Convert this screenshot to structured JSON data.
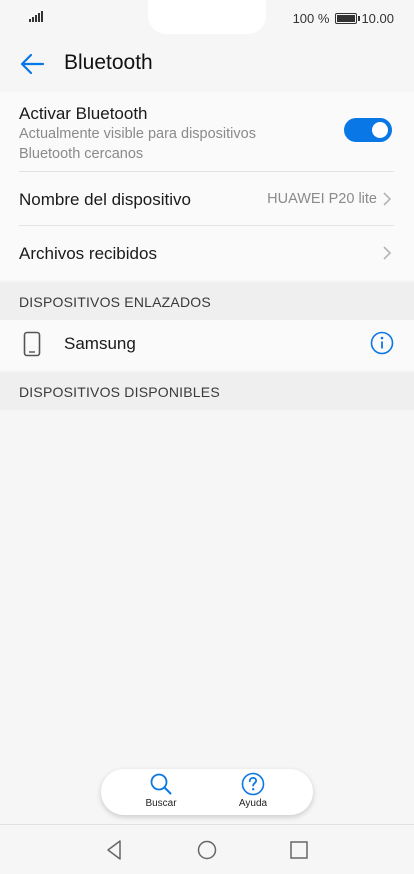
{
  "status_bar": {
    "battery_percent": "100 %",
    "time": "10.00"
  },
  "header": {
    "title": "Bluetooth"
  },
  "bluetooth_toggle": {
    "title": "Activar Bluetooth",
    "subtitle": "Actualmente visible para dispositivos Bluetooth cercanos",
    "enabled": true
  },
  "device_name": {
    "label": "Nombre del dispositivo",
    "value": "HUAWEI P20 lite"
  },
  "received_files": {
    "label": "Archivos recibidos"
  },
  "paired_section": {
    "label": "DISPOSITIVOS ENLAZADOS"
  },
  "paired_devices": [
    {
      "name": "Samsung"
    }
  ],
  "available_section": {
    "label": "DISPOSITIVOS DISPONIBLES"
  },
  "toolbar": {
    "search_label": "Buscar",
    "help_label": "Ayuda"
  },
  "colors": {
    "accent": "#0a77e6",
    "background": "#f6f6f6",
    "secondary_text": "#8a8a8a"
  },
  "icons": {
    "back": "back-arrow-icon",
    "chevron": "chevron-right-icon",
    "phone": "phone-icon",
    "info": "info-icon",
    "search": "search-icon",
    "help": "help-icon",
    "nav_back": "nav-back-icon",
    "nav_home": "nav-home-icon",
    "nav_recents": "nav-recents-icon"
  }
}
